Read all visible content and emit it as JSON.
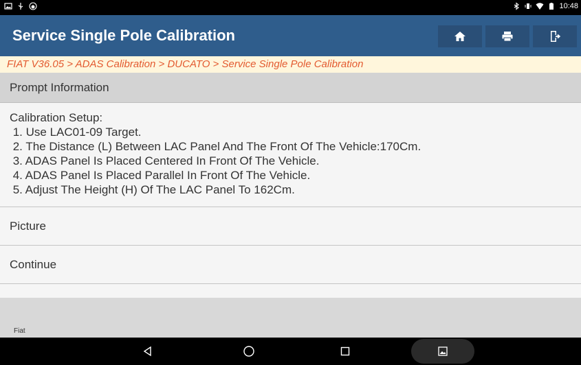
{
  "status_bar": {
    "time": "10:48",
    "left_icons": [
      "gallery-icon",
      "usb-icon",
      "android-debug-icon"
    ],
    "right_icons": [
      "bluetooth-icon",
      "vibrate-icon",
      "wifi-icon",
      "battery-icon"
    ]
  },
  "header": {
    "title": "Service Single Pole Calibration",
    "buttons": [
      "home-icon",
      "print-icon",
      "exit-icon"
    ],
    "bg_color": "#2f5d8c"
  },
  "breadcrumb": "FIAT V36.05 > ADAS Calibration > DUCATO > Service Single Pole Calibration",
  "section": {
    "title": "Prompt Information"
  },
  "content": {
    "lines": [
      "Calibration Setup:",
      " 1. Use LAC01-09 Target.",
      " 2. The Distance (L) Between LAC Panel And The Front Of The Vehicle:170Cm.",
      " 3. ADAS Panel Is Placed Centered In Front Of The Vehicle.",
      " 4. ADAS Panel Is Placed Parallel In Front Of The Vehicle.",
      " 5. Adjust The Height (H) Of The LAC Panel To 162Cm."
    ]
  },
  "actions": {
    "picture": "Picture",
    "continue": "Continue"
  },
  "footer": {
    "label": "Fiat"
  },
  "nav": [
    "back-icon",
    "home-circle-icon",
    "recents-icon",
    "screenshot-icon"
  ]
}
